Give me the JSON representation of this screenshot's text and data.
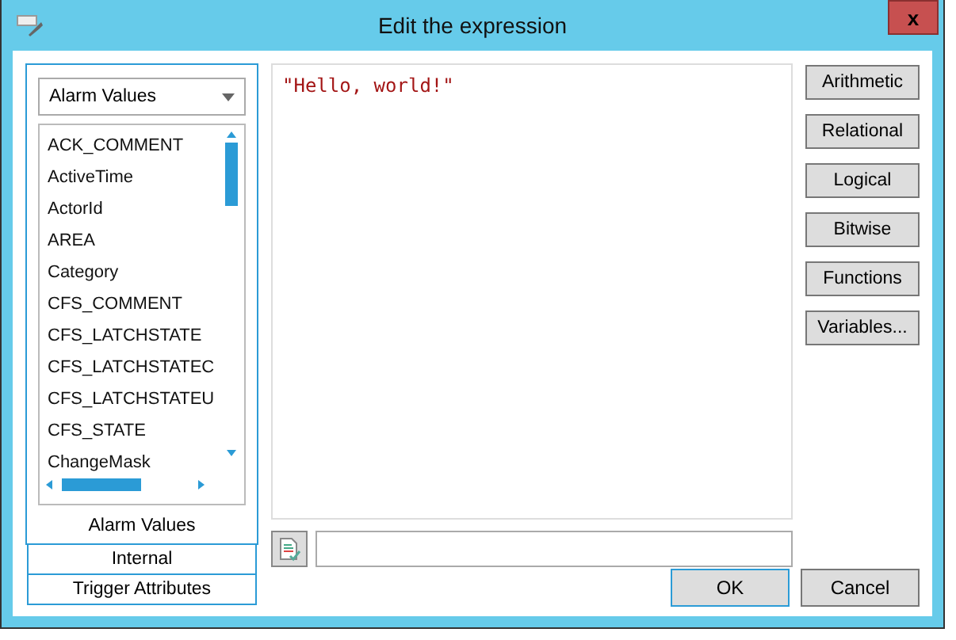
{
  "window": {
    "title": "Edit the expression",
    "close": "x"
  },
  "source": {
    "value": "Alarm Values"
  },
  "fields": [
    "ACK_COMMENT",
    "ActiveTime",
    "ActorId",
    "AREA",
    "Category",
    "CFS_COMMENT",
    "CFS_LATCHSTATE",
    "CFS_LATCHSTATEC",
    "CFS_LATCHSTATEU",
    "CFS_STATE",
    "ChangeMask"
  ],
  "sections": [
    {
      "label": "Alarm Values",
      "selected": true
    },
    {
      "label": "Internal",
      "selected": false
    },
    {
      "label": "Trigger Attributes",
      "selected": false
    }
  ],
  "expression": "\"Hello, world!\"",
  "operator_buttons": [
    "Arithmetic",
    "Relational",
    "Logical",
    "Bitwise",
    "Functions",
    "Variables..."
  ],
  "buttons": [
    {
      "label": "OK",
      "selected": true
    },
    {
      "label": "Cancel",
      "selected": false
    }
  ]
}
